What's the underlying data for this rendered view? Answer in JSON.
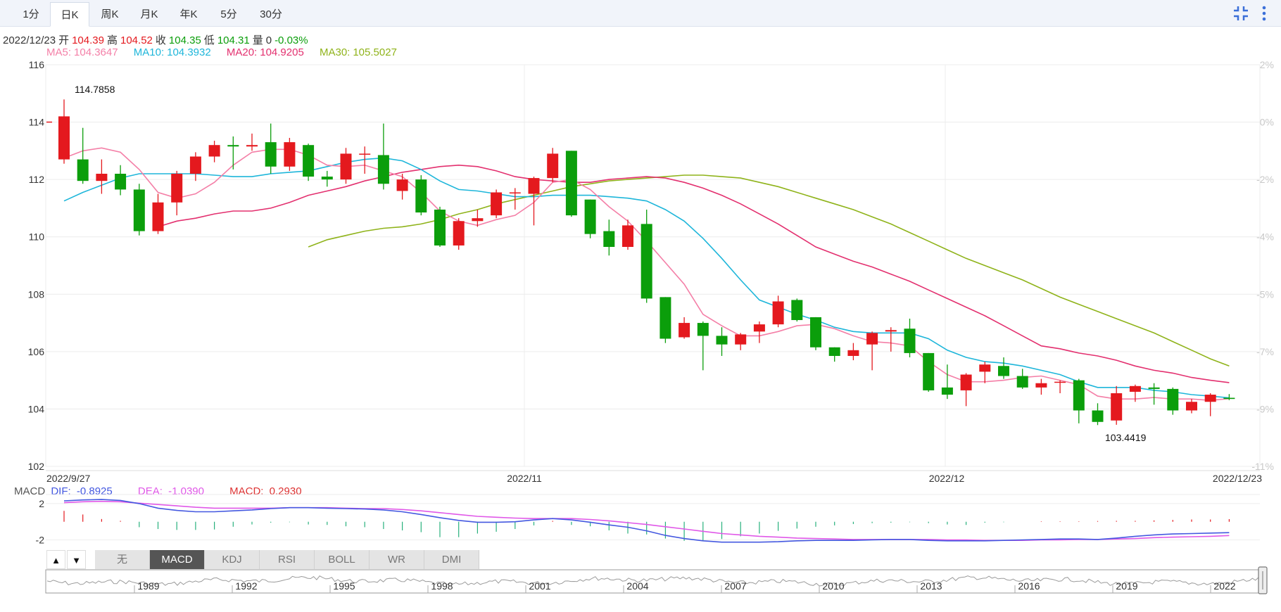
{
  "tabs": [
    {
      "label": "1分",
      "active": false
    },
    {
      "label": "日K",
      "active": true
    },
    {
      "label": "周K",
      "active": false
    },
    {
      "label": "月K",
      "active": false
    },
    {
      "label": "年K",
      "active": false
    },
    {
      "label": "5分",
      "active": false
    },
    {
      "label": "30分",
      "active": false
    }
  ],
  "toolbar": {
    "collapse_icon": "collapse-icon",
    "more_icon": "more-vertical-icon"
  },
  "info": {
    "date": "2022/12/23",
    "open_label": "开",
    "open": "104.39",
    "high_label": "高",
    "high": "104.52",
    "close_label": "收",
    "close": "104.35",
    "low_label": "低",
    "low": "104.31",
    "volume_label": "量",
    "volume": "0",
    "change": "-0.03%"
  },
  "ma_legend": [
    {
      "label": "MA5:",
      "value": "104.3647",
      "color": "#f47fa7"
    },
    {
      "label": "MA10:",
      "value": "104.3932",
      "color": "#1eb6da"
    },
    {
      "label": "MA20:",
      "value": "104.9205",
      "color": "#e3306f"
    },
    {
      "label": "MA30:",
      "value": "105.5027",
      "color": "#8fb31a"
    }
  ],
  "macd_legend": {
    "name": "MACD",
    "dif_label": "DIF:",
    "dif": "-0.8925",
    "dea_label": "DEA:",
    "dea": "-1.0390",
    "macd_label": "MACD:",
    "macd": "0.2930"
  },
  "indicator_buttons": [
    "无",
    "MACD",
    "KDJ",
    "RSI",
    "BOLL",
    "WR",
    "DMI"
  ],
  "active_indicator": "MACD",
  "arrow_up": "▲",
  "arrow_down": "▼",
  "colors": {
    "up": "#e4191e",
    "down": "#0b9e0b",
    "grid": "#ececec",
    "dif": "#4458e0",
    "dea": "#e058e8",
    "axis_text": "#333",
    "pct_text": "#c8c8c8"
  },
  "chart_data": {
    "type": "candlestick",
    "y_ticks": [
      "116",
      "114",
      "112",
      "110",
      "108",
      "106",
      "104",
      "102"
    ],
    "ylim": [
      102,
      116
    ],
    "pct_ticks": [
      "2%",
      "0%",
      "-2%",
      "-4%",
      "-5%",
      "-7%",
      "-9%",
      "-11%"
    ],
    "x_labels": [
      "2022/9/27",
      "2022/11",
      "2022/12",
      "2022/12/23"
    ],
    "annotations": {
      "max": "114.7858",
      "min": "103.4419"
    },
    "candles": [
      {
        "o": 112.7,
        "c": 114.2,
        "h": 114.79,
        "l": 112.55
      },
      {
        "o": 112.7,
        "c": 111.95,
        "h": 113.8,
        "l": 111.85
      },
      {
        "o": 111.95,
        "c": 112.2,
        "h": 112.7,
        "l": 111.5
      },
      {
        "o": 112.2,
        "c": 111.65,
        "h": 112.5,
        "l": 111.45
      },
      {
        "o": 111.65,
        "c": 110.2,
        "h": 111.85,
        "l": 110.05
      },
      {
        "o": 110.2,
        "c": 111.2,
        "h": 111.5,
        "l": 110.1
      },
      {
        "o": 111.2,
        "c": 112.2,
        "h": 112.3,
        "l": 110.75
      },
      {
        "o": 112.2,
        "c": 112.8,
        "h": 112.95,
        "l": 111.95
      },
      {
        "o": 112.8,
        "c": 113.2,
        "h": 113.35,
        "l": 112.6
      },
      {
        "o": 113.2,
        "c": 113.15,
        "h": 113.5,
        "l": 112.35
      },
      {
        "o": 113.15,
        "c": 113.2,
        "h": 113.6,
        "l": 113.0
      },
      {
        "o": 113.3,
        "c": 112.45,
        "h": 113.95,
        "l": 112.2
      },
      {
        "o": 112.45,
        "c": 113.3,
        "h": 113.45,
        "l": 112.3
      },
      {
        "o": 113.2,
        "c": 112.1,
        "h": 113.25,
        "l": 111.95
      },
      {
        "o": 112.1,
        "c": 112.0,
        "h": 112.3,
        "l": 111.75
      },
      {
        "o": 112.0,
        "c": 112.9,
        "h": 113.1,
        "l": 111.85
      },
      {
        "o": 112.9,
        "c": 112.9,
        "h": 113.15,
        "l": 112.2
      },
      {
        "o": 112.85,
        "c": 111.85,
        "h": 113.95,
        "l": 111.65
      },
      {
        "o": 111.6,
        "c": 112.0,
        "h": 112.2,
        "l": 111.3
      },
      {
        "o": 112.0,
        "c": 110.85,
        "h": 112.15,
        "l": 110.75
      },
      {
        "o": 110.95,
        "c": 109.7,
        "h": 111.05,
        "l": 109.65
      },
      {
        "o": 109.7,
        "c": 110.55,
        "h": 110.65,
        "l": 109.55
      },
      {
        "o": 110.55,
        "c": 110.65,
        "h": 110.95,
        "l": 110.35
      },
      {
        "o": 110.75,
        "c": 111.55,
        "h": 111.65,
        "l": 110.65
      },
      {
        "o": 111.55,
        "c": 111.55,
        "h": 111.7,
        "l": 110.95
      },
      {
        "o": 111.5,
        "c": 112.05,
        "h": 112.1,
        "l": 110.4
      },
      {
        "o": 112.05,
        "c": 112.9,
        "h": 113.1,
        "l": 111.9
      },
      {
        "o": 113.0,
        "c": 110.75,
        "h": 113.0,
        "l": 110.7
      },
      {
        "o": 111.3,
        "c": 110.1,
        "h": 111.3,
        "l": 109.95
      },
      {
        "o": 110.2,
        "c": 109.65,
        "h": 110.6,
        "l": 109.35
      },
      {
        "o": 109.65,
        "c": 110.4,
        "h": 110.6,
        "l": 109.55
      },
      {
        "o": 110.45,
        "c": 107.85,
        "h": 110.95,
        "l": 107.7
      },
      {
        "o": 107.9,
        "c": 106.45,
        "h": 107.9,
        "l": 106.3
      },
      {
        "o": 106.5,
        "c": 107.0,
        "h": 107.2,
        "l": 106.45
      },
      {
        "o": 107.0,
        "c": 106.55,
        "h": 107.05,
        "l": 105.35
      },
      {
        "o": 106.55,
        "c": 106.25,
        "h": 106.85,
        "l": 105.85
      },
      {
        "o": 106.25,
        "c": 106.6,
        "h": 106.65,
        "l": 106.05
      },
      {
        "o": 106.7,
        "c": 106.95,
        "h": 107.05,
        "l": 106.3
      },
      {
        "o": 106.95,
        "c": 107.75,
        "h": 107.95,
        "l": 106.85
      },
      {
        "o": 107.8,
        "c": 107.1,
        "h": 107.85,
        "l": 107.05
      },
      {
        "o": 107.2,
        "c": 106.15,
        "h": 107.2,
        "l": 106.05
      },
      {
        "o": 106.15,
        "c": 105.85,
        "h": 106.15,
        "l": 105.65
      },
      {
        "o": 105.85,
        "c": 106.05,
        "h": 106.3,
        "l": 105.7
      },
      {
        "o": 106.25,
        "c": 106.65,
        "h": 106.7,
        "l": 105.35
      },
      {
        "o": 106.7,
        "c": 106.75,
        "h": 106.85,
        "l": 106.0
      },
      {
        "o": 106.8,
        "c": 105.95,
        "h": 107.15,
        "l": 105.8
      },
      {
        "o": 105.95,
        "c": 104.65,
        "h": 105.95,
        "l": 104.6
      },
      {
        "o": 104.75,
        "c": 104.5,
        "h": 105.55,
        "l": 104.35
      },
      {
        "o": 104.65,
        "c": 105.2,
        "h": 105.25,
        "l": 104.1
      },
      {
        "o": 105.3,
        "c": 105.55,
        "h": 105.65,
        "l": 104.9
      },
      {
        "o": 105.5,
        "c": 105.15,
        "h": 105.8,
        "l": 105.05
      },
      {
        "o": 105.15,
        "c": 104.75,
        "h": 105.4,
        "l": 104.7
      },
      {
        "o": 104.75,
        "c": 104.9,
        "h": 105.05,
        "l": 104.5
      },
      {
        "o": 104.95,
        "c": 104.95,
        "h": 105.0,
        "l": 104.55
      },
      {
        "o": 105.0,
        "c": 103.95,
        "h": 105.05,
        "l": 103.5
      },
      {
        "o": 103.95,
        "c": 103.55,
        "h": 104.2,
        "l": 103.44
      },
      {
        "o": 103.6,
        "c": 104.55,
        "h": 104.8,
        "l": 103.45
      },
      {
        "o": 104.6,
        "c": 104.8,
        "h": 104.85,
        "l": 104.25
      },
      {
        "o": 104.75,
        "c": 104.7,
        "h": 104.9,
        "l": 104.15
      },
      {
        "o": 104.7,
        "c": 103.95,
        "h": 104.75,
        "l": 103.8
      },
      {
        "o": 103.95,
        "c": 104.25,
        "h": 104.35,
        "l": 103.85
      },
      {
        "o": 104.25,
        "c": 104.5,
        "h": 104.55,
        "l": 103.75
      },
      {
        "o": 104.39,
        "c": 104.35,
        "h": 104.52,
        "l": 104.31
      }
    ],
    "ma5": [
      112.75,
      113.0,
      113.1,
      112.95,
      112.35,
      111.55,
      111.35,
      111.5,
      111.9,
      112.5,
      112.95,
      113.05,
      113.05,
      112.85,
      112.5,
      112.45,
      112.5,
      112.3,
      112.1,
      111.55,
      110.9,
      110.55,
      110.4,
      110.6,
      110.75,
      111.2,
      111.9,
      112.0,
      111.65,
      111.05,
      110.55,
      109.85,
      109.1,
      108.35,
      107.3,
      106.9,
      106.55,
      106.55,
      106.7,
      106.9,
      106.95,
      106.8,
      106.55,
      106.35,
      106.3,
      106.2,
      105.65,
      105.2,
      104.95,
      104.95,
      105.0,
      105.1,
      105.15,
      105.0,
      104.85,
      104.45,
      104.35,
      104.35,
      104.4,
      104.35,
      104.35,
      104.3,
      104.36
    ],
    "ma10": [
      111.25,
      111.55,
      111.8,
      112.05,
      112.2,
      112.2,
      112.2,
      112.2,
      112.15,
      112.1,
      112.1,
      112.2,
      112.25,
      112.3,
      112.45,
      112.6,
      112.7,
      112.75,
      112.65,
      112.35,
      111.95,
      111.65,
      111.6,
      111.5,
      111.4,
      111.4,
      111.45,
      111.45,
      111.45,
      111.4,
      111.35,
      111.25,
      110.95,
      110.55,
      109.95,
      109.25,
      108.5,
      107.8,
      107.55,
      107.3,
      107.1,
      106.85,
      106.7,
      106.65,
      106.65,
      106.65,
      106.45,
      106.05,
      105.8,
      105.65,
      105.6,
      105.5,
      105.35,
      105.2,
      104.95,
      104.75,
      104.75,
      104.75,
      104.65,
      104.6,
      104.5,
      104.45,
      104.39
    ],
    "ma20": [
      110.35,
      110.55,
      110.65,
      110.8,
      110.9,
      110.9,
      111.0,
      111.2,
      111.45,
      111.6,
      111.75,
      111.95,
      112.1,
      112.25,
      112.35,
      112.45,
      112.5,
      112.45,
      112.3,
      112.1,
      112.0,
      111.95,
      111.9,
      111.9,
      112.0,
      112.05,
      112.1,
      112.05,
      111.9,
      111.7,
      111.45,
      111.15,
      110.8,
      110.45,
      110.05,
      109.65,
      109.4,
      109.15,
      108.95,
      108.7,
      108.45,
      108.15,
      107.85,
      107.55,
      107.25,
      106.9,
      106.55,
      106.2,
      106.1,
      105.95,
      105.85,
      105.7,
      105.5,
      105.35,
      105.25,
      105.1,
      105.0,
      104.92
    ],
    "ma30": [
      109.65,
      109.9,
      110.05,
      110.2,
      110.3,
      110.35,
      110.45,
      110.6,
      110.8,
      110.95,
      111.15,
      111.3,
      111.45,
      111.6,
      111.75,
      111.85,
      111.95,
      112.0,
      112.05,
      112.1,
      112.15,
      112.15,
      112.1,
      112.05,
      111.9,
      111.75,
      111.55,
      111.35,
      111.15,
      110.95,
      110.7,
      110.45,
      110.15,
      109.85,
      109.55,
      109.25,
      109.0,
      108.75,
      108.5,
      108.2,
      107.9,
      107.65,
      107.4,
      107.15,
      106.9,
      106.65,
      106.35,
      106.05,
      105.75,
      105.5
    ],
    "macd_y_ticks": [
      "2",
      "-2"
    ],
    "macd": {
      "dif": [
        2.3,
        2.4,
        2.45,
        2.35,
        2.0,
        1.5,
        1.25,
        1.1,
        1.1,
        1.2,
        1.3,
        1.45,
        1.55,
        1.55,
        1.5,
        1.45,
        1.4,
        1.3,
        1.1,
        0.8,
        0.45,
        0.15,
        -0.05,
        -0.05,
        0.0,
        0.2,
        0.35,
        0.2,
        -0.05,
        -0.35,
        -0.6,
        -1.0,
        -1.5,
        -1.85,
        -2.1,
        -2.25,
        -2.25,
        -2.25,
        -2.2,
        -2.1,
        -2.05,
        -2.05,
        -2.05,
        -2.0,
        -1.95,
        -1.95,
        -2.05,
        -2.1,
        -2.1,
        -2.1,
        -2.05,
        -2.0,
        -1.95,
        -1.9,
        -1.9,
        -1.95,
        -1.8,
        -1.6,
        -1.45,
        -1.35,
        -1.3,
        -1.25,
        -1.2
      ],
      "dea": [
        2.1,
        2.2,
        2.25,
        2.2,
        2.05,
        1.9,
        1.75,
        1.6,
        1.5,
        1.5,
        1.5,
        1.5,
        1.55,
        1.55,
        1.55,
        1.5,
        1.45,
        1.45,
        1.35,
        1.2,
        1.0,
        0.8,
        0.6,
        0.5,
        0.4,
        0.35,
        0.35,
        0.35,
        0.25,
        0.1,
        -0.1,
        -0.3,
        -0.55,
        -0.8,
        -1.05,
        -1.3,
        -1.45,
        -1.6,
        -1.7,
        -1.8,
        -1.85,
        -1.9,
        -1.95,
        -1.95,
        -1.95,
        -1.95,
        -1.95,
        -2.0,
        -2.0,
        -2.05,
        -2.05,
        -2.05,
        -2.0,
        -2.0,
        -1.95,
        -1.95,
        -1.9,
        -1.85,
        -1.75,
        -1.7,
        -1.65,
        -1.6,
        -1.52
      ],
      "hist": [
        1.2,
        0.8,
        0.3,
        0.1,
        -0.6,
        -0.8,
        -0.9,
        -0.9,
        -0.85,
        -0.55,
        -0.3,
        -0.1,
        -0.05,
        -0.3,
        -0.35,
        -0.5,
        -0.6,
        -0.8,
        -0.95,
        -1.15,
        -1.7,
        -1.7,
        -1.3,
        -1.1,
        -0.8,
        -0.4,
        0.1,
        -0.35,
        -0.5,
        -0.95,
        -1.3,
        -1.4,
        -1.85,
        -2.1,
        -2.1,
        -1.9,
        -1.6,
        -1.3,
        -1.0,
        -0.75,
        -0.55,
        -0.4,
        -0.25,
        -0.15,
        -0.1,
        -0.05,
        -0.15,
        -0.3,
        -0.35,
        -0.1,
        -0.05,
        0.0,
        0.05,
        0.05,
        0.05,
        0.08,
        0.1,
        0.1,
        0.15,
        0.2,
        0.25,
        0.25,
        0.29
      ]
    },
    "overview": {
      "years": [
        "1989",
        "1992",
        "1995",
        "1998",
        "2001",
        "2004",
        "2007",
        "2010",
        "2013",
        "2016",
        "2019",
        "2022"
      ]
    }
  }
}
